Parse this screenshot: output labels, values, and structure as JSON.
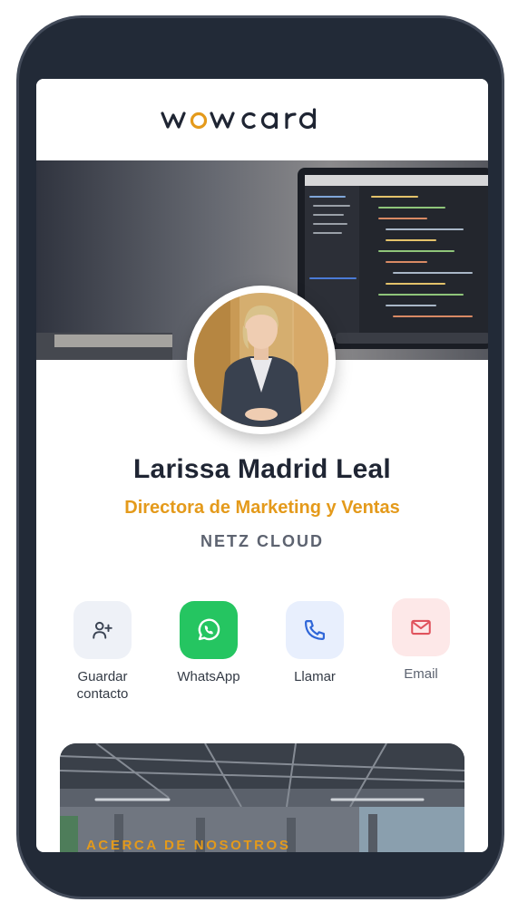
{
  "brand": {
    "logo_text": "wowcard"
  },
  "profile": {
    "name": "Larissa Madrid Leal",
    "role": "Directora de Marketing y Ventas",
    "company": "NETZ CLOUD"
  },
  "actions": [
    {
      "label": "Guardar contacto",
      "icon": "add-user-icon"
    },
    {
      "label": "WhatsApp",
      "icon": "whatsapp-icon"
    },
    {
      "label": "Llamar",
      "icon": "phone-icon"
    },
    {
      "label": "Email",
      "icon": "mail-icon"
    }
  ],
  "about": {
    "title": "ACERCA DE NOSOTROS"
  },
  "colors": {
    "accent": "#e49a1b",
    "whatsapp": "#25c561",
    "phone_bg": "#e8effd",
    "email_bg": "#fde8e8",
    "save_bg": "#eef1f7",
    "frame": "#222a37"
  }
}
